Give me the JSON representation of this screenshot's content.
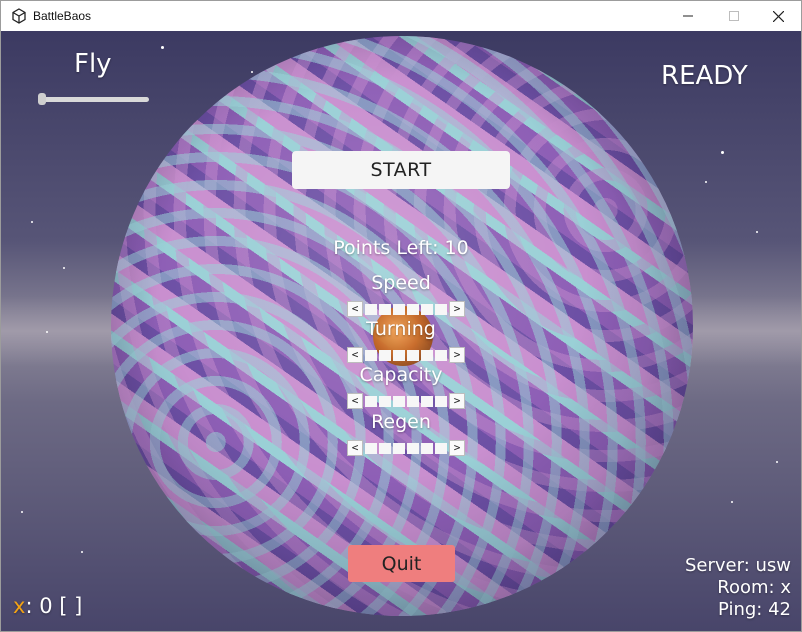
{
  "window": {
    "title": "BattleBaos",
    "controls": {
      "minimize_icon": "minimize-icon",
      "maximize_icon": "maximize-icon",
      "close_icon": "close-icon"
    }
  },
  "hud": {
    "fly_label": "Fly",
    "fly_slider_value": 0,
    "status_label": "READY",
    "start_button": "START",
    "points_left": "Points Left: 10",
    "stats": [
      {
        "label": "Speed",
        "dec": "<",
        "inc": ">",
        "filled": 0,
        "max": 6
      },
      {
        "label": "Turning",
        "dec": "<",
        "inc": ">",
        "filled": 0,
        "max": 6
      },
      {
        "label": "Capacity",
        "dec": "<",
        "inc": ">",
        "filled": 0,
        "max": 6
      },
      {
        "label": "Regen",
        "dec": "<",
        "inc": ">",
        "filled": 0,
        "max": 6
      }
    ],
    "quit_button": "Quit",
    "server": "Server: usw",
    "room": "Room: x",
    "ping": "Ping: 42",
    "score_key": "x",
    "score_value": ": 0 [ ]"
  },
  "colors": {
    "quit_button": "#ef7e7e",
    "score_key": "#f2a214",
    "start_button": "#f5f5f5"
  }
}
